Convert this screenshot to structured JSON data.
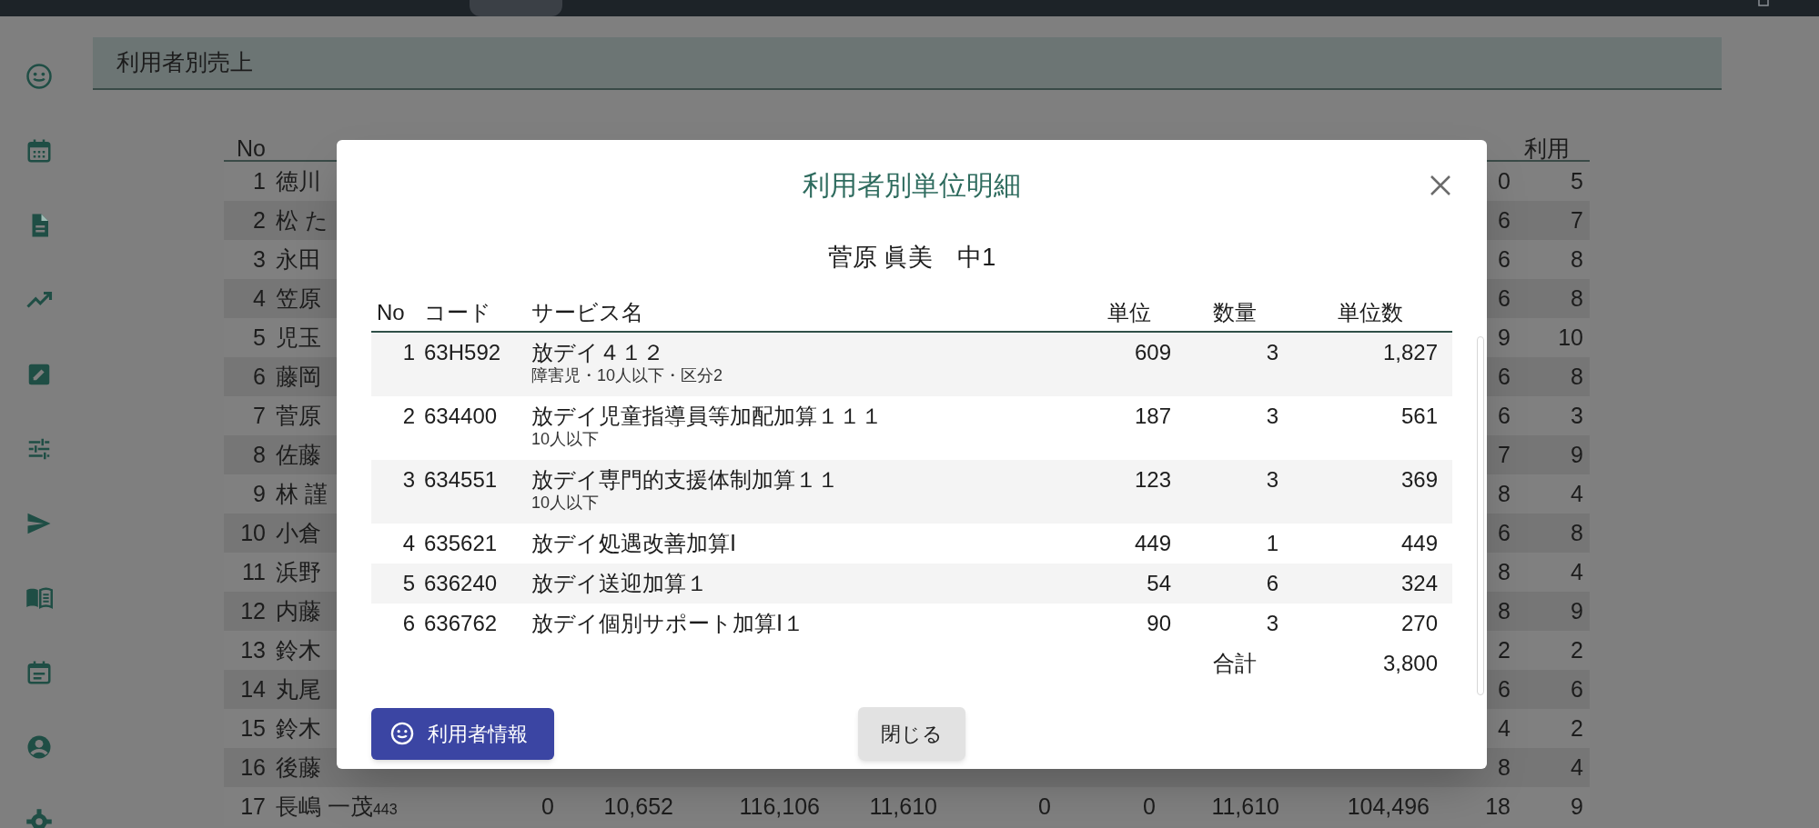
{
  "page_title": "利用者別売上",
  "sales_table": {
    "header": {
      "no": "No",
      "usage": "利用"
    },
    "rows": [
      {
        "no": "1",
        "name": "徳川",
        "column_11": "0",
        "usage": "5"
      },
      {
        "no": "2",
        "name": "松 た",
        "column_11": "6",
        "usage": "7"
      },
      {
        "no": "3",
        "name": "永田",
        "column_11": "6",
        "usage": "8"
      },
      {
        "no": "4",
        "name": "笠原",
        "column_11": "6",
        "usage": "8"
      },
      {
        "no": "5",
        "name": "児玉",
        "column_11": "9",
        "usage": "10"
      },
      {
        "no": "6",
        "name": "藤岡",
        "column_11": "6",
        "usage": "8"
      },
      {
        "no": "7",
        "name": "菅原",
        "column_11": "6",
        "usage": "3"
      },
      {
        "no": "8",
        "name": "佐藤",
        "column_11": "7",
        "usage": "9"
      },
      {
        "no": "9",
        "name": "林 謹",
        "column_11": "8",
        "usage": "4"
      },
      {
        "no": "10",
        "name": "小倉",
        "column_11": "6",
        "usage": "8"
      },
      {
        "no": "11",
        "name": "浜野",
        "column_11": "8",
        "usage": "4"
      },
      {
        "no": "12",
        "name": "内藤",
        "column_11": "8",
        "usage": "9"
      },
      {
        "no": "13",
        "name": "鈴木",
        "column_11": "2",
        "usage": "2"
      },
      {
        "no": "14",
        "name": "丸尾",
        "column_11": "6",
        "usage": "6"
      },
      {
        "no": "15",
        "name": "鈴木",
        "column_11": "4",
        "usage": "2"
      },
      {
        "no": "16",
        "name": "後藤",
        "column_11": "8",
        "usage": "4"
      },
      {
        "no": "17",
        "name": "長嶋 一茂",
        "name_suffix": "443",
        "cells": [
          "0",
          "10,652",
          "116,106",
          "11,610",
          "0",
          "0",
          "11,610",
          "104,496"
        ],
        "column_11": "18",
        "usage": "9"
      }
    ]
  },
  "dialog": {
    "title": "利用者別単位明細",
    "person": "菅原 眞美　中1",
    "columns": {
      "no": "No",
      "code": "コード",
      "service": "サービス名",
      "unit": "単位",
      "quantity": "数量",
      "units": "単位数"
    },
    "rows": [
      {
        "no": "1",
        "code": "63H592",
        "service": "放デイ４１２",
        "note": "障害児・10人以下・区分2",
        "unit": "609",
        "quantity": "3",
        "units": "1,827"
      },
      {
        "no": "2",
        "code": "634400",
        "service": "放デイ児童指導員等加配加算１１１",
        "note": "10人以下",
        "unit": "187",
        "quantity": "3",
        "units": "561"
      },
      {
        "no": "3",
        "code": "634551",
        "service": "放デイ専門的支援体制加算１１",
        "note": "10人以下",
        "unit": "123",
        "quantity": "3",
        "units": "369"
      },
      {
        "no": "4",
        "code": "635621",
        "service": "放デイ処遇改善加算Ⅰ",
        "unit": "449",
        "quantity": "1",
        "units": "449"
      },
      {
        "no": "5",
        "code": "636240",
        "service": "放デイ送迎加算１",
        "unit": "54",
        "quantity": "6",
        "units": "324"
      },
      {
        "no": "6",
        "code": "636762",
        "service": "放デイ個別サポート加算Ⅰ１",
        "unit": "90",
        "quantity": "3",
        "units": "270"
      }
    ],
    "total": {
      "label": "合計",
      "value": "3,800"
    },
    "info_button": "利用者情報",
    "close_button": "閉じる"
  }
}
